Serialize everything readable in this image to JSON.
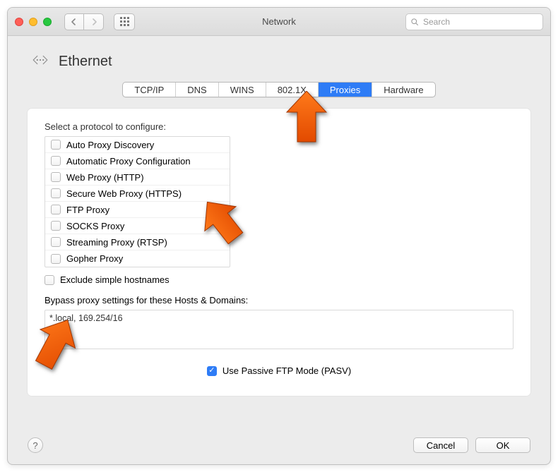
{
  "window": {
    "title": "Network",
    "search_placeholder": "Search"
  },
  "header": {
    "title": "Ethernet"
  },
  "tabs": [
    {
      "label": "TCP/IP",
      "selected": false
    },
    {
      "label": "DNS",
      "selected": false
    },
    {
      "label": "WINS",
      "selected": false
    },
    {
      "label": "802.1X",
      "selected": false
    },
    {
      "label": "Proxies",
      "selected": true
    },
    {
      "label": "Hardware",
      "selected": false
    }
  ],
  "panel": {
    "select_label": "Select a protocol to configure:",
    "protocols": [
      {
        "label": "Auto Proxy Discovery",
        "checked": false
      },
      {
        "label": "Automatic Proxy Configuration",
        "checked": false
      },
      {
        "label": "Web Proxy (HTTP)",
        "checked": false
      },
      {
        "label": "Secure Web Proxy (HTTPS)",
        "checked": false
      },
      {
        "label": "FTP Proxy",
        "checked": false
      },
      {
        "label": "SOCKS Proxy",
        "checked": false
      },
      {
        "label": "Streaming Proxy (RTSP)",
        "checked": false
      },
      {
        "label": "Gopher Proxy",
        "checked": false
      }
    ],
    "exclude_label": "Exclude simple hostnames",
    "exclude_checked": false,
    "bypass_label": "Bypass proxy settings for these Hosts & Domains:",
    "bypass_value": "*.local, 169.254/16",
    "pasv_label": "Use Passive FTP Mode (PASV)",
    "pasv_checked": true
  },
  "buttons": {
    "help": "?",
    "cancel": "Cancel",
    "ok": "OK"
  }
}
